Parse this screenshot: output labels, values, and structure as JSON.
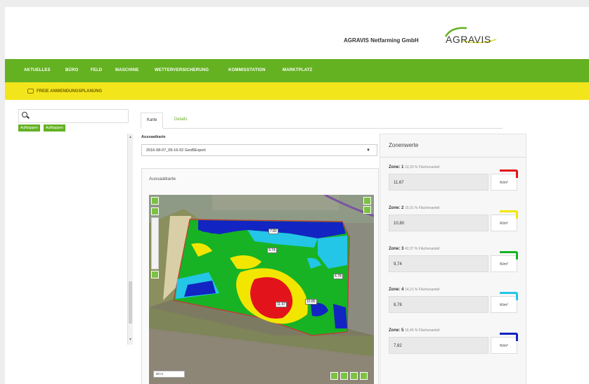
{
  "header": {
    "company_name": "AGRAVIS Netfarming GmbH",
    "logo_text": "AGRAVIS",
    "brand_green": "#64b122",
    "accent_yellow": "#f3e51b"
  },
  "nav": {
    "items": [
      "AKTUELLES",
      "BÜRO",
      "FELD",
      "MASCHINE",
      "WETTERVERSICHERUNG",
      "KOMMISSTATION",
      "MARKTPLATZ"
    ]
  },
  "subnav": {
    "item": "FREIE ANWENDUNGSPLANUNG",
    "icon": "edit-icon"
  },
  "sidebar": {
    "expand_label": "Aufklappen",
    "collapse_label": "Aufklappen"
  },
  "tabs": [
    {
      "label": "Karte",
      "active": true
    },
    {
      "label": "Details",
      "active": false
    }
  ],
  "selector": {
    "label": "Aussaatkarte",
    "value": "2016-08-07_09-16-02 GeoBExport"
  },
  "map": {
    "title": "Aussaatkarte",
    "labels": [
      "6.78",
      "7.82",
      "9.74",
      "11.67",
      "10.80"
    ],
    "scale": "50 m"
  },
  "zones": {
    "title": "Zonenwerte",
    "unit": "K/m²",
    "share_suffix": "% Flächenanteil",
    "items": [
      {
        "name": "Zone: 1",
        "share": "10,20",
        "value": "11,67",
        "color": "#e3131b"
      },
      {
        "name": "Zone: 2",
        "share": "15,01",
        "value": "10,80",
        "color": "#f2e600"
      },
      {
        "name": "Zone: 3",
        "share": "42,07",
        "value": "9,74",
        "color": "#17b324"
      },
      {
        "name": "Zone: 4",
        "share": "14,21",
        "value": "8,78",
        "color": "#23c6e6"
      },
      {
        "name": "Zone: 5",
        "share": "16,45",
        "value": "7,82",
        "color": "#1224c2"
      }
    ]
  }
}
